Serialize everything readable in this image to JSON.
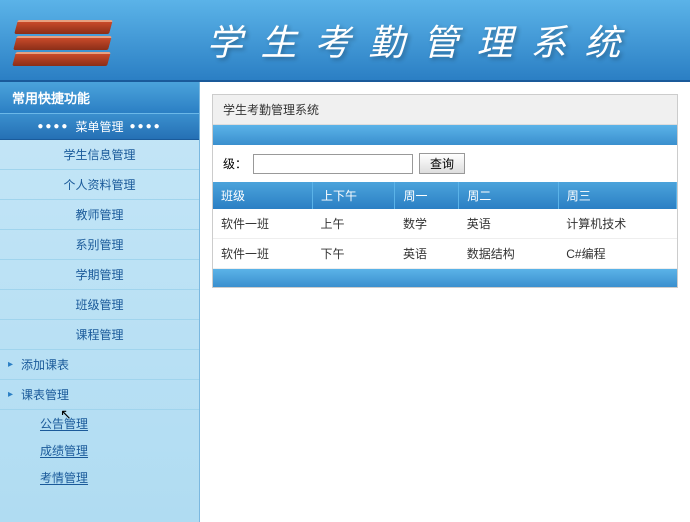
{
  "header": {
    "title": "学生考勤管理系统"
  },
  "sidebar": {
    "header": "常用快捷功能",
    "active_label": "菜单管理",
    "items": [
      {
        "label": "学生信息管理"
      },
      {
        "label": "个人资料管理"
      },
      {
        "label": "教师管理"
      },
      {
        "label": "系别管理"
      },
      {
        "label": "学期管理"
      },
      {
        "label": "班级管理"
      },
      {
        "label": "课程管理"
      }
    ],
    "arrow_items": [
      {
        "label": "添加课表"
      },
      {
        "label": "课表管理"
      }
    ],
    "sub_items": [
      {
        "label": "公告管理"
      },
      {
        "label": "成绩管理"
      },
      {
        "label": "考情管理"
      }
    ]
  },
  "content": {
    "title": "学生考勤管理系统",
    "search": {
      "label": "级：",
      "button": "查询",
      "value": ""
    },
    "table": {
      "headers": [
        "班级",
        "上下午",
        "周一",
        "周二",
        "周三"
      ],
      "rows": [
        [
          "软件一班",
          "上午",
          "数学",
          "英语",
          "计算机技术"
        ],
        [
          "软件一班",
          "下午",
          "英语",
          "数据结构",
          "C#编程"
        ]
      ]
    }
  }
}
